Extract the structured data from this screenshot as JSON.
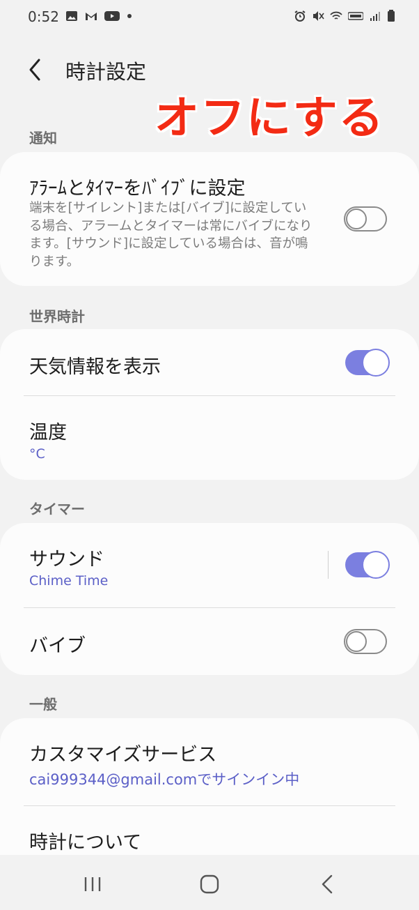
{
  "status": {
    "time": "0:52",
    "left_icons": [
      "gallery-icon",
      "gmail-icon",
      "youtube-icon",
      "dot-icon"
    ],
    "right_icons": [
      "alarm-icon",
      "mute-vibrate-icon",
      "wifi-icon",
      "volte-icon",
      "signal-icon",
      "battery-icon"
    ]
  },
  "header": {
    "title": "時計設定",
    "back_icon": "back-chevron-icon"
  },
  "annotation": {
    "text": "オフにする",
    "color": "#f32b14"
  },
  "sections": {
    "notify": {
      "label": "通知",
      "vibrate_alarm": {
        "title": "ｱﾗｰﾑとﾀｲﾏｰをﾊﾞｲﾌﾞに設定",
        "desc": "端末を[サイレント]または[バイブ]に設定している場合、アラームとタイマーは常にバイブになります。[サウンド]に設定している場合は、音が鳴ります。",
        "state": "off"
      }
    },
    "world_clock": {
      "label": "世界時計",
      "weather": {
        "title": "天気情報を表示",
        "state": "on"
      },
      "temperature": {
        "title": "温度",
        "value": "°C"
      }
    },
    "timer": {
      "label": "タイマー",
      "sound": {
        "title": "サウンド",
        "value": "Chime Time",
        "state": "on"
      },
      "vibrate": {
        "title": "バイブ",
        "state": "off"
      }
    },
    "general": {
      "label": "一般",
      "customize": {
        "title": "カスタマイズサービス",
        "value": "cai999344@gmail.comでサインイン中"
      },
      "about": {
        "title": "時計について"
      }
    }
  },
  "navbar": {
    "recent_icon": "recent-apps-icon",
    "home_icon": "home-icon",
    "back_icon": "nav-back-icon"
  },
  "colors": {
    "accent": "#7b7fe0",
    "link": "#5b5fc7",
    "background": "#f2f2f2",
    "card": "#fcfcfc",
    "annotation": "#f32b14"
  }
}
